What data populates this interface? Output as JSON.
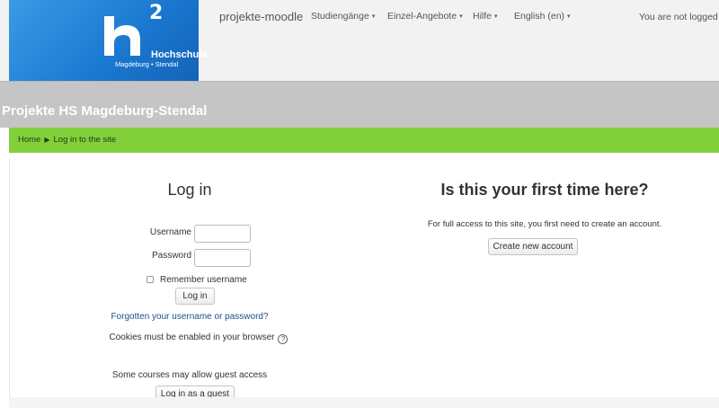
{
  "navbar": {
    "logo": {
      "superscript": "2",
      "name": "Hochschule",
      "subtitle": "Magdeburg • Stendal"
    },
    "brand": "projekte-moodle",
    "menu": [
      {
        "label": "Studiengänge",
        "caret": "▾"
      },
      {
        "label": "Einzel-Angebote",
        "caret": "▾"
      },
      {
        "label": "Hilfe",
        "caret": "▾"
      },
      {
        "label": "English (en)",
        "caret": "▾"
      }
    ],
    "user_status": "You are not logged in."
  },
  "header": {
    "site_title": "Projekte HS Magdeburg-Stendal"
  },
  "breadcrumb": {
    "home": "Home",
    "separator": "▶",
    "current": "Log in to the site"
  },
  "login": {
    "title": "Log in",
    "username_label": "Username",
    "username_value": "",
    "password_label": "Password",
    "password_value": "",
    "remember_label": "Remember username",
    "remember_checked": false,
    "login_button": "Log in",
    "forgot_link": "Forgotten your username or password?",
    "cookies_text": "Cookies must be enabled in your browser",
    "help_icon": "?",
    "guest_text": "Some courses may allow guest access",
    "guest_button": "Log in as a guest"
  },
  "signup": {
    "title": "Is this your first time here?",
    "text": "For full access to this site, you first need to create an account.",
    "create_button": "Create new account"
  },
  "colors": {
    "brand_blue": "#1a78d0",
    "breadcrumb_green": "#82cf3c",
    "header_gray": "#c5c5c5",
    "link_blue": "#1b4f8a"
  }
}
